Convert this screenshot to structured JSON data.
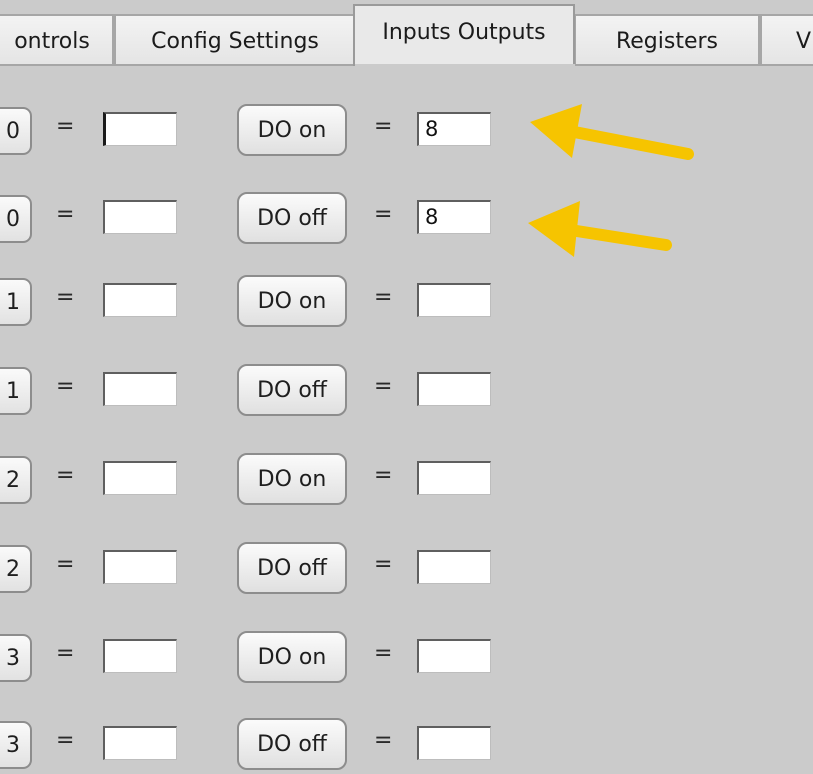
{
  "tabs": [
    {
      "label": "ontrols",
      "active": false
    },
    {
      "label": "Config Settings",
      "active": false
    },
    {
      "label": "Inputs Outputs",
      "active": true
    },
    {
      "label": "Registers",
      "active": false
    },
    {
      "label": "V",
      "active": false
    }
  ],
  "rows": [
    {
      "index_label": "0",
      "input_value": "",
      "button_label": "DO on",
      "output_value": "8"
    },
    {
      "index_label": "0",
      "input_value": "",
      "button_label": "DO off",
      "output_value": "8"
    },
    {
      "index_label": "1",
      "input_value": "",
      "button_label": "DO on",
      "output_value": ""
    },
    {
      "index_label": "1",
      "input_value": "",
      "button_label": "DO off",
      "output_value": ""
    },
    {
      "index_label": "2",
      "input_value": "",
      "button_label": "DO on",
      "output_value": ""
    },
    {
      "index_label": "2",
      "input_value": "",
      "button_label": "DO off",
      "output_value": ""
    },
    {
      "index_label": "3",
      "input_value": "",
      "button_label": "DO on",
      "output_value": ""
    },
    {
      "index_label": "3",
      "input_value": "",
      "button_label": "DO off",
      "output_value": ""
    }
  ],
  "equals_sign": "=",
  "colors": {
    "background": "#cbcbcb",
    "annotation_arrow": "#f6c400"
  },
  "annotations": [
    {
      "type": "arrow-icon",
      "points_to": "rows.0.output_value"
    },
    {
      "type": "arrow-icon",
      "points_to": "rows.1.output_value"
    }
  ]
}
